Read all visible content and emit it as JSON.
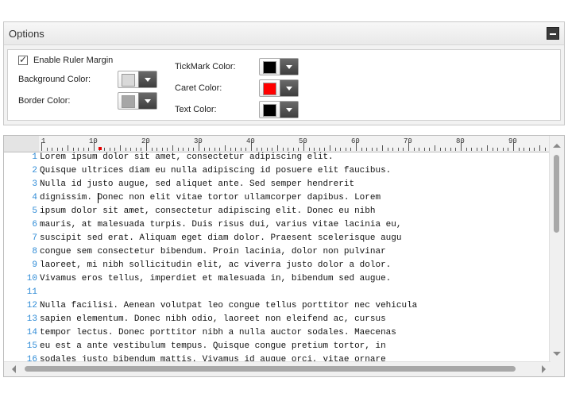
{
  "options": {
    "title": "Options",
    "enable_ruler_margin_label": "Enable Ruler Margin",
    "enable_ruler_margin_checked": true,
    "background_color_label": "Background Color:",
    "border_color_label": "Border Color:",
    "tickmark_color_label": "TickMark Color:",
    "caret_color_label": "Caret Color:",
    "text_color_label": "Text Color:",
    "colors": {
      "background": "#d9d9d9",
      "border": "#a6a6a6",
      "tickmark": "#000000",
      "caret": "#ff0000",
      "text": "#000000"
    }
  },
  "ruler": {
    "labels": [
      "1",
      "10",
      "20",
      "30",
      "40",
      "50",
      "60",
      "70",
      "80",
      "90"
    ]
  },
  "editor": {
    "lines": [
      {
        "n": "1",
        "text": "Lorem ipsum dolor sit amet, consectetur adipiscing elit."
      },
      {
        "n": "2",
        "text": "Quisque ultrices diam eu nulla adipiscing id posuere elit faucibus."
      },
      {
        "n": "3",
        "text": "Nulla id justo augue, sed aliquet ante. Sed semper hendrerit"
      },
      {
        "n": "4",
        "text": "dignissim. Donec non elit vitae tortor ullamcorper dapibus. Lorem"
      },
      {
        "n": "5",
        "text": "ipsum dolor sit amet, consectetur adipiscing elit. Donec eu nibh"
      },
      {
        "n": "6",
        "text": "mauris, at malesuada turpis. Duis risus dui, varius vitae lacinia eu,"
      },
      {
        "n": "7",
        "text": "suscipit sed erat. Aliquam eget diam dolor. Praesent scelerisque augu"
      },
      {
        "n": "8",
        "text": "congue sem consectetur bibendum. Proin lacinia, dolor non pulvinar"
      },
      {
        "n": "9",
        "text": "laoreet, mi nibh sollicitudin elit, ac viverra justo dolor a dolor."
      },
      {
        "n": "10",
        "text": "Vivamus eros tellus, imperdiet et malesuada in, bibendum sed augue."
      },
      {
        "n": "11",
        "text": ""
      },
      {
        "n": "12",
        "text": "Nulla facilisi. Aenean volutpat leo congue tellus porttitor nec vehicula"
      },
      {
        "n": "13",
        "text": "sapien elementum. Donec nibh odio, laoreet non eleifend ac, cursus"
      },
      {
        "n": "14",
        "text": "tempor lectus. Donec porttitor nibh a nulla auctor sodales. Maecenas"
      },
      {
        "n": "15",
        "text": "eu est a ante vestibulum tempus. Quisque congue pretium tortor, in"
      },
      {
        "n": "16",
        "text": "sodales justo bibendum mattis. Vivamus id augue orci, vitae ornare"
      }
    ]
  }
}
